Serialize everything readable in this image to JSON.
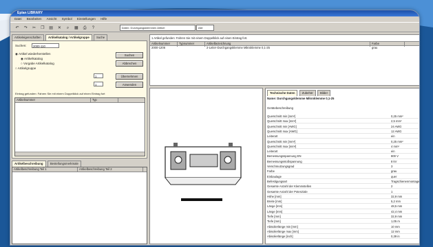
{
  "colors": {
    "accent": "#1e5fa3",
    "panel": "#fffbe6",
    "window": "#d4d0c8"
  },
  "title": "Eplan LIBRARY",
  "menu": [
    "Datei",
    "Bearbeiten",
    "Ansicht",
    "Symbol",
    "Einstellungen",
    "Hilfe"
  ],
  "toolbar": {
    "icons": [
      "undo-icon",
      "redo-icon",
      "cut-icon",
      "copy-icon",
      "paste-icon",
      "delete-icon",
      "find-icon",
      "table-icon",
      "print-icon",
      "help-icon"
    ],
    "select1": "Daten: Durchgangsklemmen Artikel",
    "select2": "Alle"
  },
  "left": {
    "tabs": [
      "Artikeleigenschaften",
      "Artikelkatalog / Artikelgruppe",
      "Suche"
    ],
    "search_label": "Suchen:",
    "search_value": "2000-110",
    "options": [
      "Artikel wiederherstellen",
      "Artikelkatalog",
      "Vorgabe Artikelkatalog",
      "Artikelgruppe"
    ],
    "btn_search": "Suchen",
    "btn_abort": "Abbrechen",
    "btn_take": "Übernehmen",
    "btn_apply": "Anwenden",
    "num1": "1",
    "num2": "1",
    "found_label": "Eintrag gefunden: Fahren Sie mit einem Doppelklick auf einen Eintrag fort",
    "grid1_cols": [
      "Artikelnummer",
      "Typ"
    ],
    "bottom_tabs": [
      "Artikelbeschreibung",
      "Bestellungsmerkmale"
    ],
    "grid2_cols": [
      "Artikelbeschreibung Teil 1",
      "Artikelbeschreibung Teil 2"
    ]
  },
  "right": {
    "info_label": "1 Artikel gefunden: Fahren Sie mit einem Doppelklick auf einen Eintrag fort.",
    "cols": [
      "Artikelnummer",
      "Typnummer",
      "Artikelbezeichnung",
      "Farbe"
    ],
    "row": [
      "2000-1206",
      "",
      "2-Leiter-Durchgangsklemme Mikroklemme 0,1-25",
      "grau"
    ],
    "prop_tabs": [
      "Technische Daten",
      "Zubehör",
      "Bilder"
    ],
    "header": "Name: Durchgangsklemme Mikroklemme 0,1-25",
    "subheader": "Gerätebeschreibung",
    "props": [
      [
        "Querschnitt min [mm²]",
        "0,25 mm²"
      ],
      [
        "Querschnitt max [mm²]",
        "2,5 mm²"
      ],
      [
        "Querschnitt min [AWG]",
        "24 AWG"
      ],
      [
        "Querschnitt max [AWG]",
        "12 AWG"
      ],
      [
        "Leiterart",
        "ein"
      ],
      [
        "Querschnitt min [mm²]",
        "0,25 mm²"
      ],
      [
        "Querschnitt max [mm²]",
        "4 mm²"
      ],
      [
        "Leiterart",
        "ein"
      ],
      [
        "Bemessungsspannung EN",
        "800 V"
      ],
      [
        "Bemessungsstoßspannung",
        "8 kV"
      ],
      [
        "Verschmutzungsgrad",
        "3"
      ],
      [
        "Farbe",
        "grau"
      ],
      [
        "Einbaulage",
        "quer"
      ],
      [
        "Befestigungsart",
        "Tragschienenmontage"
      ],
      [
        "Gesamte Anzahl der Klemmstellen",
        "2"
      ],
      [
        "Gesamte Anzahl der Potenziale",
        "1"
      ],
      [
        "Höhe [mm]",
        "32,9 mm"
      ],
      [
        "Breite [mm]",
        "5,2 mm"
      ],
      [
        "Länge [mm]",
        "48,5 mm"
      ],
      [
        "Länge [mm]",
        "42,4 mm"
      ],
      [
        "Tiefe [mm]",
        "32,9 mm"
      ],
      [
        "Tiefe [mm]",
        "1,05 m"
      ],
      [
        "Abisolierlänge min [mm]",
        "10 mm"
      ],
      [
        "Abisolierlänge max [mm]",
        "12 mm"
      ],
      [
        "Abisolierlänge [inch]",
        "0,39 in"
      ]
    ]
  }
}
